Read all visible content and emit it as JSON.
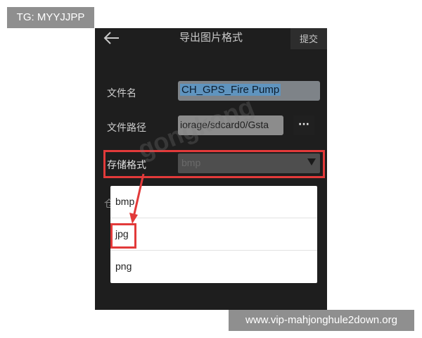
{
  "overlay": {
    "tag": "TG: MYYJJPP",
    "url": "www.vip-mahjonghule2down.org"
  },
  "header": {
    "back_icon": "arrow-left-icon",
    "title": "导出图片格式",
    "submit_label": "提交"
  },
  "form": {
    "file_name": {
      "label": "文件名",
      "value": "CH_GPS_Fire Pump"
    },
    "file_path": {
      "label": "文件路径",
      "value": "iorage/sdcard0/Gsta",
      "more_label": "···"
    },
    "format": {
      "label": "存储格式",
      "selected": "bmp",
      "arrow_icon": "triangle-down-icon"
    }
  },
  "dropdown": {
    "hidden_letter": "仓",
    "options": [
      {
        "label": "bmp"
      },
      {
        "label": "jpg",
        "highlighted": true
      },
      {
        "label": "png"
      }
    ]
  },
  "annotations": {
    "highlight_color": "#e23a3a"
  },
  "watermark": {
    "text": "gongkong"
  }
}
